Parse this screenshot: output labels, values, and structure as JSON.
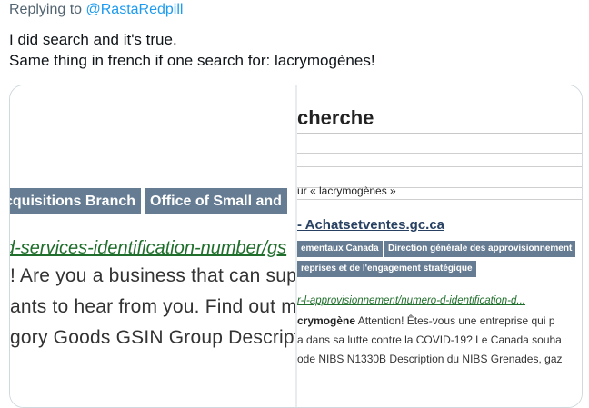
{
  "tweet": {
    "replying_prefix": "Replying to",
    "replying_handle": "@RastaRedpill",
    "text": "I did search and it's true.\nSame thing in french if one search for: lacrymogènes!"
  },
  "left_screenshot": {
    "tabs": [
      "cquisitions Branch",
      "Office of Small and"
    ],
    "url": "d-services-identification-number/gs",
    "lines": [
      "! Are you a business that can supp",
      "ants to hear from you. Find out m",
      "gory Goods GSIN Group Descriptio"
    ]
  },
  "right_screenshot": {
    "title": "cherche",
    "search_text": "ur « lacrymogènes »",
    "result_title": "- Achatsetventes.gc.ca",
    "crumbs": [
      "ementaux Canada",
      "Direction générale des approvisionnement",
      "reprises et de l'engagement stratégique"
    ],
    "url": "r-l-approvisionnement/numero-d-identification-d...",
    "line1_bold": "crymogène",
    "line1_rest": " Attention! Êtes-vous une entreprise qui p",
    "line2": "a dans sa lutte contre la COVID-19? Le Canada souha",
    "line3": "ode NIBS N1330B Description du NIBS Grenades, gaz"
  }
}
